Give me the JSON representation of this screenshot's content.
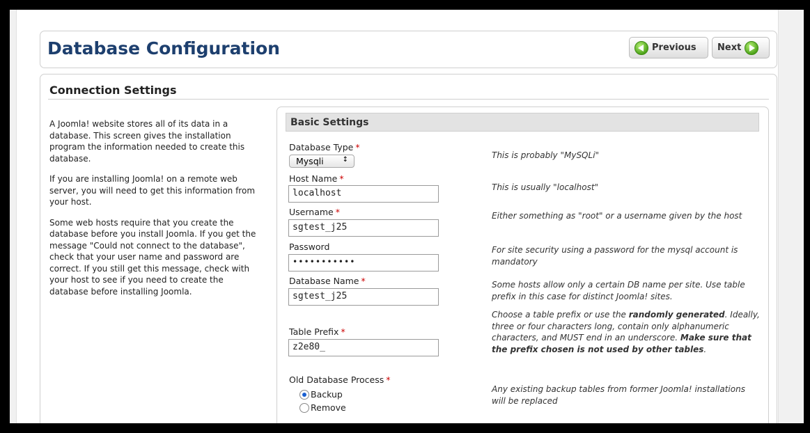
{
  "header": {
    "title": "Database Configuration",
    "prev_label": "Previous",
    "next_label": "Next"
  },
  "section": {
    "title": "Connection Settings",
    "intro": [
      "A Joomla! website stores all of its data in a database. This screen gives the installation program the information needed to create this database.",
      "If you are installing Joomla! on a remote web server, you will need to get this information from your host.",
      "Some web hosts require that you create the database before you install Joomla. If you get the message \"Could not connect to the database\", check that your user name and password are correct. If you still get this message, check with your host to see if you need to create the database before installing Joomla."
    ]
  },
  "basic": {
    "title": "Basic Settings",
    "required_mark": "*",
    "db_type": {
      "label": "Database Type",
      "value": "Mysqli",
      "dropdown_glyph": "↕",
      "hint": "This is probably \"MySQLi\""
    },
    "host": {
      "label": "Host Name",
      "value": "localhost",
      "hint": "This is usually \"localhost\""
    },
    "username": {
      "label": "Username",
      "value": "sgtest_j25",
      "hint": "Either something as \"root\" or a username given by the host"
    },
    "password": {
      "label": "Password",
      "value": "•••••••••••",
      "hint": "For site security using a password for the mysql account is mandatory"
    },
    "db_name": {
      "label": "Database Name",
      "value": "sgtest_j25",
      "hint": "Some hosts allow only a certain DB name per site. Use table prefix in this case for distinct Joomla! sites."
    },
    "prefix": {
      "label": "Table Prefix",
      "value": "z2e80_",
      "hint_a": "Choose a table prefix or use the ",
      "hint_b": "randomly generated",
      "hint_c": ". Ideally, three or four characters long, contain only alphanumeric characters, and MUST end in an underscore. ",
      "hint_d": "Make sure that the prefix chosen is not used by other tables",
      "hint_e": "."
    },
    "old_db": {
      "label": "Old Database Process",
      "options": [
        "Backup",
        "Remove"
      ],
      "selected": "Backup",
      "hint": "Any existing backup tables from former Joomla! installations will be replaced"
    }
  }
}
